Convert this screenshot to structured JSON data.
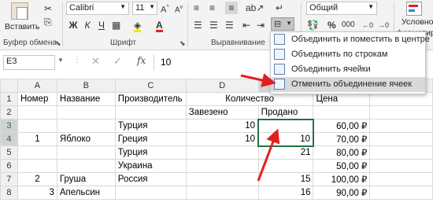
{
  "ribbon": {
    "paste_label": "Вставить",
    "clipboard_label": "Буфер обмена",
    "font_name": "Calibri",
    "font_size": "11",
    "font_group_label": "Шрифт",
    "bold": "Ж",
    "italic": "К",
    "underline": "Ч",
    "align_group_label": "Выравнивание",
    "number_format": "Общий",
    "percent": "%",
    "thousands": "000",
    "cond_format_label": "Условно",
    "cond_format_label2": "форматир"
  },
  "formula_bar": {
    "name_box": "E3",
    "fx": "fx",
    "value": "10"
  },
  "merge_menu": {
    "items": [
      {
        "label": "Объединить и поместить в центре"
      },
      {
        "label": "Объединить по строкам"
      },
      {
        "label": "Объединить ячейки"
      },
      {
        "label": "Отменить объединение ячеек"
      }
    ]
  },
  "sheet": {
    "columns": [
      "A",
      "B",
      "C",
      "D",
      "E",
      "F"
    ],
    "rows": [
      {
        "num": "1",
        "cells": [
          "Номер",
          "Название",
          "Производитель",
          "Количество",
          "",
          "Цена"
        ]
      },
      {
        "num": "2",
        "cells": [
          "",
          "",
          "",
          "Завезено",
          "Продано",
          ""
        ]
      },
      {
        "num": "3",
        "cells": [
          "",
          "",
          "Турция",
          "10",
          "",
          "60,00 ₽"
        ]
      },
      {
        "num": "4",
        "cells": [
          "1",
          "Яблоко",
          "Греция",
          "10",
          "10",
          "70,00 ₽"
        ]
      },
      {
        "num": "5",
        "cells": [
          "",
          "",
          "Турция",
          "",
          "21",
          "80,00 ₽"
        ]
      },
      {
        "num": "6",
        "cells": [
          "",
          "",
          "Украина",
          "",
          "",
          "50,00 ₽"
        ]
      },
      {
        "num": "7",
        "cells": [
          "2",
          "Груша",
          "Россия",
          "",
          "15",
          "100,00 ₽"
        ]
      },
      {
        "num": "8",
        "cells": [
          "3",
          "Апельсин",
          "",
          "",
          "16",
          "90,00 ₽"
        ]
      }
    ]
  },
  "colors": {
    "accent_green": "#217346",
    "arrow_red": "#e02020"
  }
}
